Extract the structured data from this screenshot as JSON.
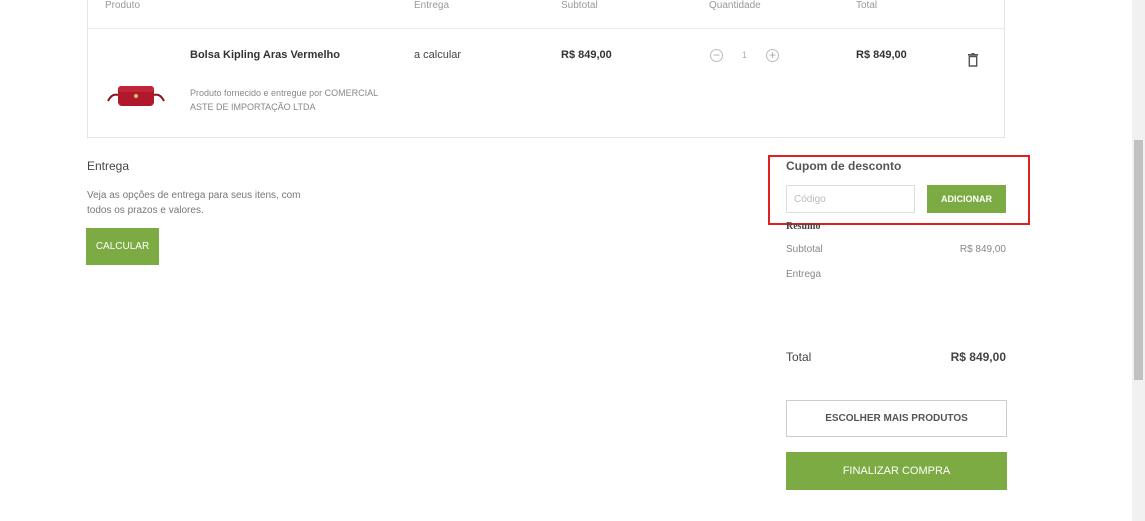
{
  "table": {
    "headers": {
      "produto": "Produto",
      "entrega": "Entrega",
      "subtotal": "Subtotal",
      "quantidade": "Quantidade",
      "total": "Total"
    },
    "item": {
      "name": "Bolsa Kipling Aras Vermelho",
      "seller": "Produto fornecido e entregue por COMERCIAL ASTE DE IMPORTAÇÃO LTDA",
      "entrega": "a calcular",
      "subtotal": "R$ 849,00",
      "quantity": "1",
      "total": "R$ 849,00",
      "icons": {
        "decrease": "minus-circle-icon",
        "increase": "plus-circle-icon",
        "remove": "trash-icon"
      }
    }
  },
  "entrega": {
    "title": "Entrega",
    "description": "Veja as opções de entrega para seus itens, com todos os prazos e valores.",
    "button": "CALCULAR"
  },
  "cupom": {
    "title": "Cupom de desconto",
    "placeholder": "Código",
    "value": "",
    "button": "ADICIONAR"
  },
  "resumo": {
    "title": "Resumo",
    "subtotal_label": "Subtotal",
    "subtotal_value": "R$ 849,00",
    "entrega_label": "Entrega",
    "total_label": "Total",
    "total_value": "R$ 849,00"
  },
  "actions": {
    "more_products": "ESCOLHER MAIS PRODUTOS",
    "finish": "FINALIZAR COMPRA"
  },
  "colors": {
    "accent_green": "#7cab43",
    "highlight_red": "#e02020",
    "product_red": "#b0182c"
  }
}
